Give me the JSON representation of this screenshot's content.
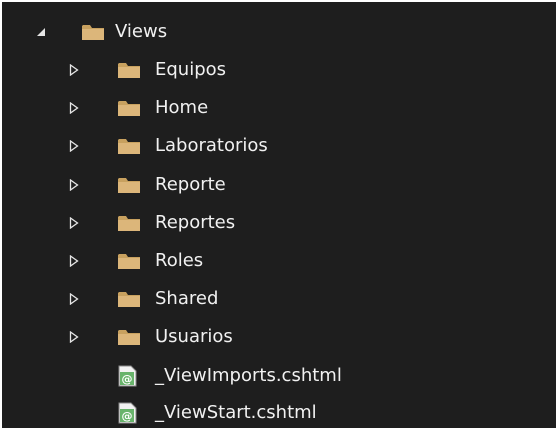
{
  "tree": {
    "root": {
      "label": "Views",
      "expanded": true,
      "icon": "folder-icon"
    },
    "folders": [
      {
        "label": "Equipos",
        "expanded": false,
        "icon": "folder-icon"
      },
      {
        "label": "Home",
        "expanded": false,
        "icon": "folder-icon"
      },
      {
        "label": "Laboratorios",
        "expanded": false,
        "icon": "folder-icon"
      },
      {
        "label": "Reporte",
        "expanded": false,
        "icon": "folder-icon"
      },
      {
        "label": "Reportes",
        "expanded": false,
        "icon": "folder-icon"
      },
      {
        "label": "Roles",
        "expanded": false,
        "icon": "folder-icon"
      },
      {
        "label": "Shared",
        "expanded": false,
        "icon": "folder-icon"
      },
      {
        "label": "Usuarios",
        "expanded": false,
        "icon": "folder-icon"
      }
    ],
    "files": [
      {
        "label": "_ViewImports.cshtml",
        "icon": "razor-file-icon"
      },
      {
        "label": "_ViewStart.cshtml",
        "icon": "razor-file-icon"
      }
    ]
  },
  "colors": {
    "background": "#1e1e1e",
    "text": "#f1f1f1",
    "folder": "#dcb67a",
    "razor": "#68b36b"
  }
}
